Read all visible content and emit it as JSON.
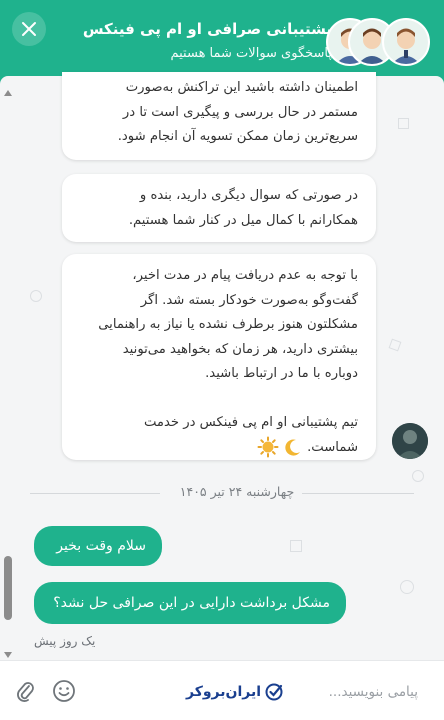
{
  "header": {
    "title": "پشتیبانی صرافی او ام پی فینکس",
    "subtitle": "پاسخگوی سوالات شما هستیم",
    "close_icon": "close-icon",
    "color": "#1fb28d"
  },
  "messages": {
    "agent": [
      {
        "lines": [
          "اطمینان داشته باشید این تراکنش به‌صورت",
          "مستمر در حال بررسی و پیگیری است تا در",
          "سریع‌ترین زمان ممکن تسویه آن انجام شود."
        ]
      },
      {
        "lines": [
          "در صورتی که سوال دیگری دارید، بنده و",
          "همکارانم با کمال میل در کنار شما هستیم."
        ]
      },
      {
        "lines": [
          "با توجه به عدم دریافت پیام در مدت اخیر،",
          "گفت‌وگو به‌صورت خودکار بسته شد. اگر",
          "مشکلتون هنوز برطرف نشده یا نیاز به راهنمایی",
          "بیشتری دارید، هر زمان که بخواهید می‌تونید",
          "دوباره با ما در ارتباط باشید.",
          "",
          "تیم پشتیبانی او ام پی فینکس در خدمت",
          "شماست."
        ],
        "emojis": [
          "crescent-moon-emoji",
          "sun-emoji"
        ]
      }
    ],
    "date_separator": "چهارشنبه ۲۴ تیر ۱۴۰۵",
    "user": [
      {
        "text": "سلام وقت بخیر"
      },
      {
        "text": "مشکل برداشت دارایی در این صرافی حل نشد؟"
      }
    ],
    "timestamp": "یک روز پیش"
  },
  "footer": {
    "placeholder": "پیامی بنویسید...",
    "brand": "ایران‌بروکر",
    "attach_icon": "paperclip-icon",
    "emoji_icon": "smile-icon"
  }
}
